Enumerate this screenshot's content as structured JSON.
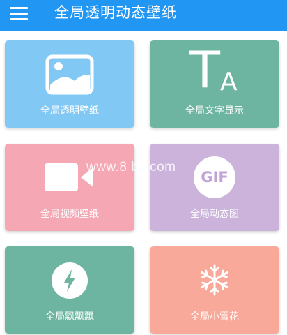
{
  "appbar": {
    "title": "全局透明动态壁纸",
    "menu_icon": "hamburger-menu-icon",
    "color": "#2196f3"
  },
  "cards": [
    {
      "label": "全局透明壁纸",
      "icon": "image-icon",
      "color": "#82c8f5"
    },
    {
      "label": "全局文字显示",
      "icon": "text-icon",
      "icon_text_big": "T",
      "icon_text_small": "A",
      "color": "#6db5a0"
    },
    {
      "label": "全局视频壁纸",
      "icon": "video-camera-icon",
      "color": "#f5a7b4"
    },
    {
      "label": "全局动态图",
      "icon": "gif-icon",
      "icon_text": "GIF",
      "color": "#cbb3dc"
    },
    {
      "label": "全局飘飘飘",
      "icon": "lightning-icon",
      "color": "#6db5a0"
    },
    {
      "label": "全局小雪花",
      "icon": "snowflake-icon",
      "color": "#f9a99a"
    }
  ],
  "watermark": "www.8   bs.com"
}
